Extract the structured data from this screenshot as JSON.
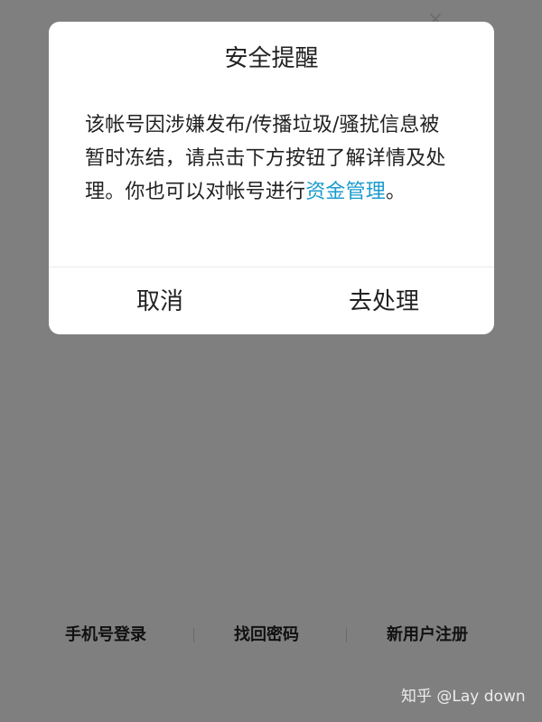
{
  "background": {
    "close_glyph": "×"
  },
  "dialog": {
    "title": "安全提醒",
    "message_plain": "该帐号因涉嫌发布/传播垃圾/骚扰信息被暂时冻结，请点击下方按钮了解详情及处理。你也可以对帐号进行",
    "message_link": "资金管理",
    "message_end": "。",
    "cancel_label": "取消",
    "handle_label": "去处理",
    "link_color": "#1a9bcf"
  },
  "bottom_links": {
    "phone_login": "手机号登录",
    "find_password": "找回密码",
    "new_user_register": "新用户注册"
  },
  "watermark": {
    "text": "知乎 @Lay down"
  }
}
